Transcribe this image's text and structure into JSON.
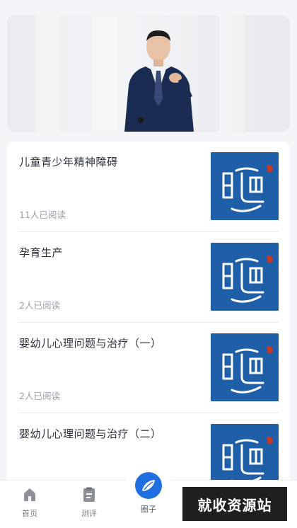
{
  "banner": {
    "alt": "banner-portrait"
  },
  "articles": [
    {
      "title": "儿童青少年精神障碍",
      "reads": "11人已阅读"
    },
    {
      "title": "孕育生产",
      "reads": "2人已阅读"
    },
    {
      "title": "婴幼儿心理问题与治疗（一）",
      "reads": "2人已阅读"
    },
    {
      "title": "婴幼儿心理问题与治疗（二）",
      "reads": ""
    }
  ],
  "tabbar": {
    "home": "首页",
    "test": "测评",
    "circle": "圈子"
  },
  "watermark": "就收资源站",
  "colors": {
    "thumb_bg": "#1f5fa8",
    "accent": "#1f6fe0"
  }
}
